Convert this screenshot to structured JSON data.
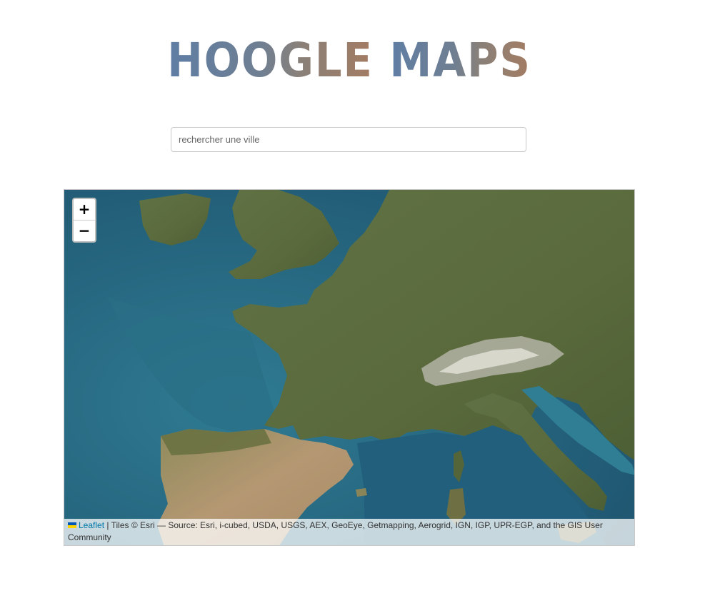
{
  "logo": {
    "word1": "HOOGLE",
    "word2": "MAPS"
  },
  "search": {
    "placeholder": "rechercher une ville",
    "value": ""
  },
  "map": {
    "zoom_in_label": "+",
    "zoom_out_label": "−",
    "attribution": {
      "flag_colors": [
        "#0057b7",
        "#ffd500"
      ],
      "leaflet_link": "Leaflet",
      "separator": "|",
      "text": "Tiles © Esri — Source: Esri, i-cubed, USDA, USGS, AEX, GeoEye, Getmapping, Aerogrid, IGN, IGP, UPR-EGP, and the GIS User Community"
    }
  },
  "colors": {
    "sea": "#2f6c87",
    "deep_sea": "#1f5570",
    "land": "#5d6e3f",
    "land_dark": "#4a5c33",
    "mountains": "#c9c6bd",
    "iberia": "#b59873",
    "link": "#0078a8"
  }
}
